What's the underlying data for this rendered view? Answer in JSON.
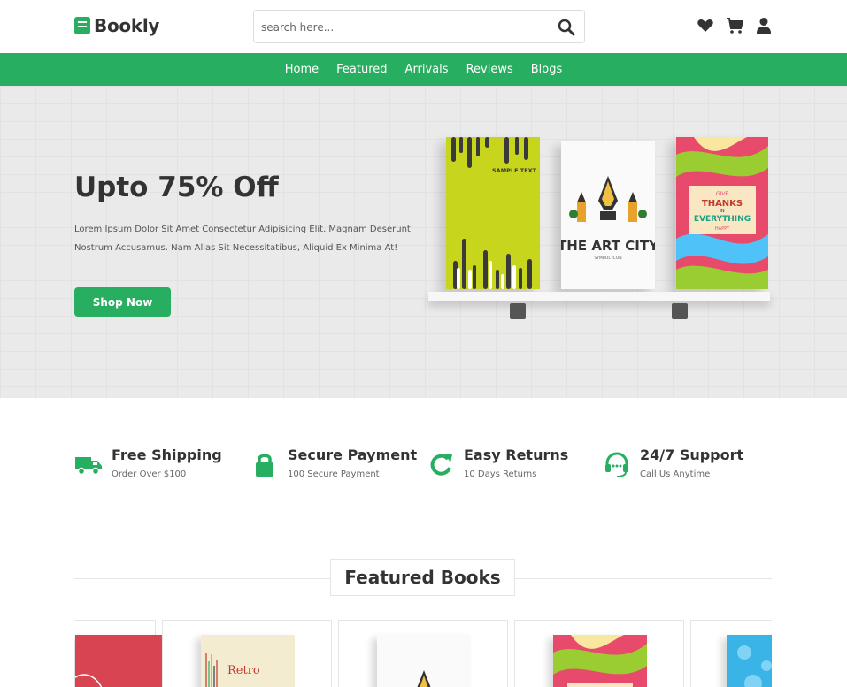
{
  "header": {
    "logo_text": "Bookly",
    "search_placeholder": "search here...",
    "icons": [
      "heart-icon",
      "cart-icon",
      "user-icon"
    ]
  },
  "nav": {
    "items": [
      "Home",
      "Featured",
      "Arrivals",
      "Reviews",
      "Blogs"
    ]
  },
  "hero": {
    "title": "Upto 75% Off",
    "text": "Lorem Ipsum Dolor Sit Amet Consectetur Adipisicing Elit. Magnam Deserunt Nostrum Accusamus. Nam Alias Sit Necessitatibus, Aliquid Ex Minima At!",
    "button": "Shop Now",
    "books": [
      {
        "cover_text": "SAMPLE TEXT"
      },
      {
        "cover_text": "THE ART CITY",
        "cover_sub": "SYMBOL ICON"
      },
      {
        "cover_text_1": "GIVE",
        "cover_text_2": "THANKS",
        "cover_text_3": "IN",
        "cover_text_4": "EVERYTHING",
        "cover_text_5": "HAPPY"
      }
    ]
  },
  "features": [
    {
      "icon": "truck-icon",
      "title": "Free Shipping",
      "sub": "Order Over $100"
    },
    {
      "icon": "lock-icon",
      "title": "Secure Payment",
      "sub": "100 Secure Payment"
    },
    {
      "icon": "redo-icon",
      "title": "Easy Returns",
      "sub": "10 Days Returns"
    },
    {
      "icon": "headset-icon",
      "title": "24/7 Support",
      "sub": "Call Us Anytime"
    }
  ],
  "featured": {
    "heading": "Featured Books",
    "card_book_text": "Retro"
  },
  "colors": {
    "accent": "#27ae60",
    "text": "#333333"
  }
}
